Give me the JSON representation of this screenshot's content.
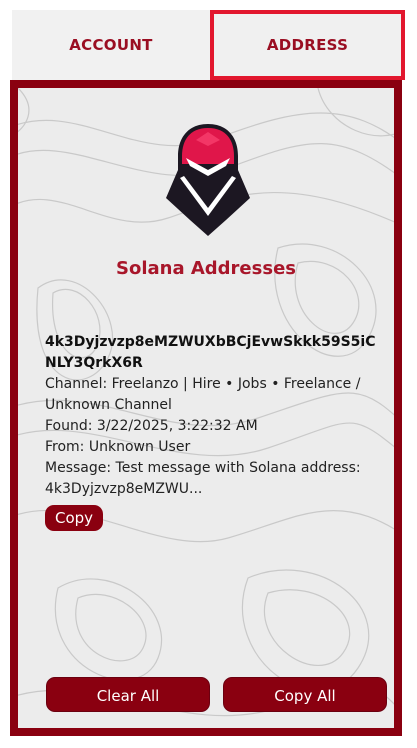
{
  "tabs": [
    {
      "label": "ACCOUNT",
      "active": false
    },
    {
      "label": "ADDRESS",
      "active": true
    }
  ],
  "panel": {
    "heading": "Solana Addresses",
    "entry": {
      "address": "4k3Dyjzvzp8eMZWUXbBCjEvwSkkk59S5iCNLY3QrkX6R",
      "channel": "Channel: Freelanzo | Hire • Jobs • Freelance / Unknown Channel",
      "found": "Found: 3/22/2025, 3:22:32 AM",
      "from": "From: Unknown User",
      "message": "Message: Test message with Solana address: 4k3Dyjzvzp8eMZWU...",
      "copy_label": "Copy"
    },
    "clear_all_label": "Clear All",
    "copy_all_label": "Copy All"
  },
  "colors": {
    "accent": "#8a0010",
    "tab_text": "#9a0e22",
    "active_tab_border": "#e2172e",
    "heading": "#a8162a"
  },
  "icons": {
    "logo": "ninja-mascot-icon"
  }
}
